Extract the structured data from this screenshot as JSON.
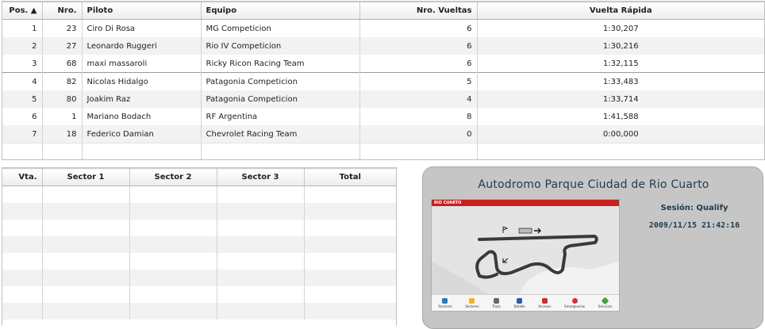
{
  "results": {
    "headers": {
      "pos": "Pos. ▲",
      "nro": "Nro.",
      "piloto": "Piloto",
      "equipo": "Equipo",
      "vueltas": "Nro. Vueltas",
      "rapida": "Vuelta Rápida"
    },
    "rows": [
      {
        "pos": "1",
        "nro": "23",
        "piloto": "Ciro Di Rosa",
        "equipo": "MG Competicion",
        "vueltas": "6",
        "rapida": "1:30,207"
      },
      {
        "pos": "2",
        "nro": "27",
        "piloto": "Leonardo Ruggeri",
        "equipo": "Rio IV Competicion",
        "vueltas": "6",
        "rapida": "1:30,216"
      },
      {
        "pos": "3",
        "nro": "68",
        "piloto": "maxi massaroli",
        "equipo": "Ricky Ricon Racing Team",
        "vueltas": "6",
        "rapida": "1:32,115"
      },
      {
        "pos": "4",
        "nro": "82",
        "piloto": "Nicolas Hidalgo",
        "equipo": "Patagonia Competicion",
        "vueltas": "5",
        "rapida": "1:33,483"
      },
      {
        "pos": "5",
        "nro": "80",
        "piloto": "Joakim Raz",
        "equipo": "Patagonia Competicion",
        "vueltas": "4",
        "rapida": "1:33,714"
      },
      {
        "pos": "6",
        "nro": "1",
        "piloto": "Mariano Bodach",
        "equipo": "RF Argentina",
        "vueltas": "8",
        "rapida": "1:41,588"
      },
      {
        "pos": "7",
        "nro": "18",
        "piloto": "Federico Damian",
        "equipo": "Chevrolet Racing Team",
        "vueltas": "0",
        "rapida": "0:00,000"
      }
    ]
  },
  "laps": {
    "headers": {
      "vta": "Vta.",
      "s1": "Sector 1",
      "s2": "Sector 2",
      "s3": "Sector 3",
      "total": "Total"
    }
  },
  "circuit": {
    "title": "Autodromo Parque Ciudad de Rio Cuarto",
    "map_label": "RIO CUARTO",
    "session": "Sesión: Qualify",
    "datetime": "2009/11/15 21:42:16",
    "toolbar": [
      {
        "label": "Sectores",
        "color": "#2a78c2"
      },
      {
        "label": "Sectores",
        "color": "#f2b418"
      },
      {
        "label": "Trazo",
        "color": "#666666"
      },
      {
        "label": "Detalle",
        "color": "#2a5cb5"
      },
      {
        "label": "Accesos",
        "color": "#d22c2c"
      },
      {
        "label": "Emergencias",
        "color": "#e03030"
      },
      {
        "label": "Servicios",
        "color": "#3ea33e"
      }
    ]
  },
  "colors": {
    "header_text": "#1f3a4d",
    "panel_bg": "#c6c6c6",
    "map_header": "#c8201f"
  }
}
